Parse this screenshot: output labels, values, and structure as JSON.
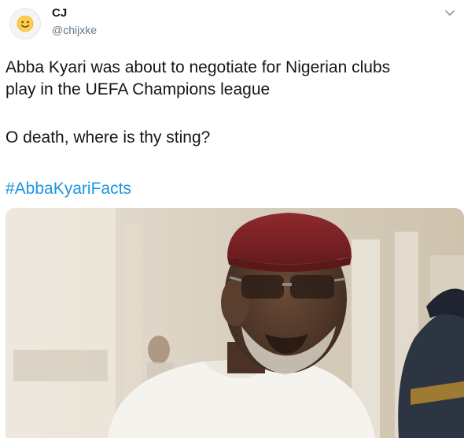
{
  "author": {
    "name": "CJ",
    "handle": "@chijxke",
    "avatar_icon": "smiley-emoji-icon"
  },
  "menu_icon": "chevron-down-icon",
  "tweet": {
    "line1": "Abba Kyari was about to negotiate for Nigerian clubs",
    "line2": "play in the UEFA Champions league",
    "line3": "O death, where is thy sting?",
    "hashtag": "#AbbaKyariFacts"
  },
  "media": {
    "type": "photo",
    "subject": "man-in-red-cap-photo"
  },
  "colors": {
    "text": "#14171a",
    "secondary": "#657786",
    "link": "#1b95e0",
    "cap": "#7c1f22"
  }
}
